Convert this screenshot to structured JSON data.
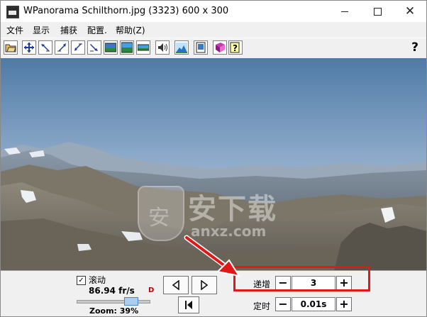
{
  "window": {
    "title": "WPanorama  Schilthorn.jpg   (3323) 600 x 300",
    "icon": "app-icon"
  },
  "menu": [
    "文件",
    "显示",
    "捕获",
    "配置.",
    "帮助(Z)"
  ],
  "toolbar": {
    "buttons": [
      "open-folder-icon",
      "move-icon",
      "rotate-left-icon",
      "zoom-in-icon",
      "zoom-out-icon",
      "fullscreen-icon",
      "view-panorama-icon",
      "view-strip-icon",
      "sound-icon",
      "landscape-icon",
      "frame-icon",
      "book-icon",
      "help-doc-icon"
    ],
    "help_label": "?"
  },
  "controls": {
    "scroll_checked": true,
    "scroll_label": "滚动",
    "speed": "86.94 fr/s",
    "zoom": "Zoom: 39%",
    "slider_value": 0.8,
    "increment_label": "递增",
    "increment_value": "3",
    "timer_label": "定时",
    "timer_value": "0.01s",
    "minus": "−",
    "plus": "+"
  },
  "watermark": {
    "cn": "安下载",
    "url": "anxz.com",
    "shield_char": "安"
  },
  "colors": {
    "highlight": "#e01818",
    "sky_top": "#4f7aa6",
    "sky_bottom": "#c6d4e2"
  }
}
